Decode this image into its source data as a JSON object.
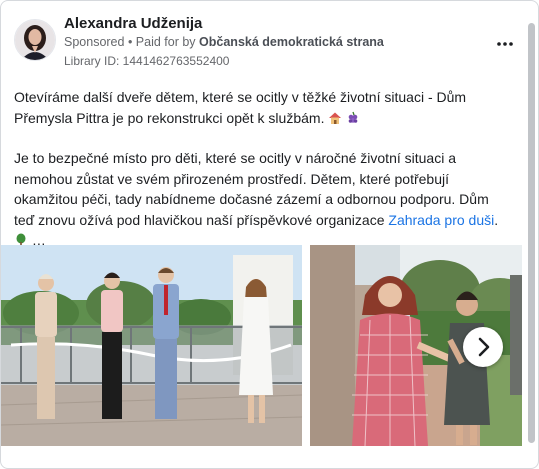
{
  "post": {
    "author": "Alexandra Udženija",
    "sponsored_label": "Sponsored",
    "paid_for_prefix": "• Paid for by",
    "payer": "Občanská demokratická strana",
    "library_id": "Library ID: 1441462763552400",
    "paragraph1": "Otevíráme další dveře dětem, které se ocitly v těžké životní situaci - Dům Přemysla Pittra je po rekonstrukci opět k službám.",
    "paragraph2_text": "Je to bezpečné místo pro děti, které se ocitly v náročné životní situaci a nemohou zůstat ve svém přirozeném prostředí. Dětem, které potřebují okamžitou péči, tady nabídneme dočasné zázemí a odbornou podporu. Dům teď znovu ožívá pod hlavičkou naší příspěvkové organizace",
    "link_text": "Zahrada pro duši",
    "see_more": "…",
    "emojis": [
      "house-icon",
      "grapes-icon",
      "tree-icon"
    ]
  },
  "carousel": {
    "images": [
      "ribbon-cutting-photo",
      "handshake-photo"
    ],
    "next_icon": "chevron-right-icon"
  }
}
